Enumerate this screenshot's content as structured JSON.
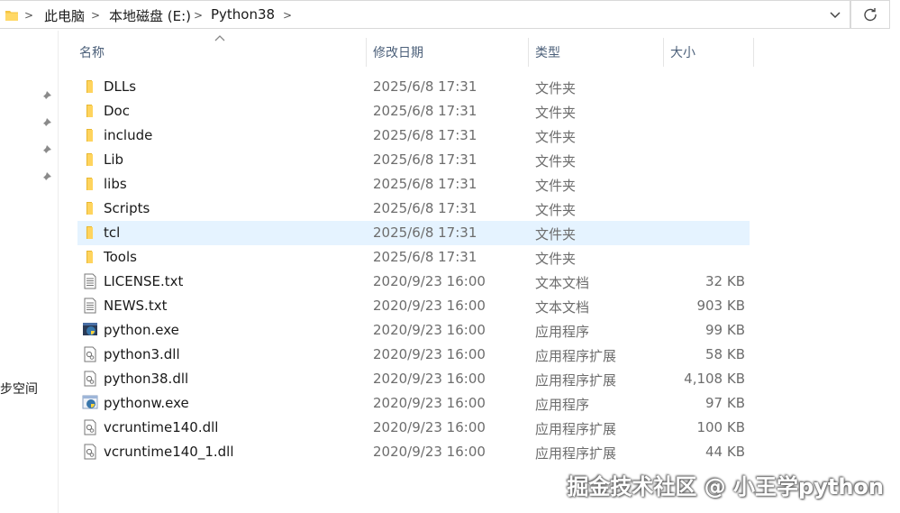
{
  "address_bar": {
    "breadcrumbs": [
      "此电脑",
      "本地磁盘 (E:)",
      "Python38"
    ]
  },
  "nav_pane": {
    "partial_label": "步空间"
  },
  "columns": {
    "name": "名称",
    "date": "修改日期",
    "type": "类型",
    "size": "大小"
  },
  "files": [
    {
      "name": "DLLs",
      "date": "2025/6/8 17:31",
      "type": "文件夹",
      "size": "",
      "icon": "folder-icon"
    },
    {
      "name": "Doc",
      "date": "2025/6/8 17:31",
      "type": "文件夹",
      "size": "",
      "icon": "folder-icon"
    },
    {
      "name": "include",
      "date": "2025/6/8 17:31",
      "type": "文件夹",
      "size": "",
      "icon": "folder-icon"
    },
    {
      "name": "Lib",
      "date": "2025/6/8 17:31",
      "type": "文件夹",
      "size": "",
      "icon": "folder-icon"
    },
    {
      "name": "libs",
      "date": "2025/6/8 17:31",
      "type": "文件夹",
      "size": "",
      "icon": "folder-icon"
    },
    {
      "name": "Scripts",
      "date": "2025/6/8 17:31",
      "type": "文件夹",
      "size": "",
      "icon": "folder-icon"
    },
    {
      "name": "tcl",
      "date": "2025/6/8 17:31",
      "type": "文件夹",
      "size": "",
      "icon": "folder-icon",
      "selected": true
    },
    {
      "name": "Tools",
      "date": "2025/6/8 17:31",
      "type": "文件夹",
      "size": "",
      "icon": "folder-icon"
    },
    {
      "name": "LICENSE.txt",
      "date": "2020/9/23 16:00",
      "type": "文本文档",
      "size": "32 KB",
      "icon": "text-file-icon"
    },
    {
      "name": "NEWS.txt",
      "date": "2020/9/23 16:00",
      "type": "文本文档",
      "size": "903 KB",
      "icon": "text-file-icon"
    },
    {
      "name": "python.exe",
      "date": "2020/9/23 16:00",
      "type": "应用程序",
      "size": "99 KB",
      "icon": "python-exe-icon"
    },
    {
      "name": "python3.dll",
      "date": "2020/9/23 16:00",
      "type": "应用程序扩展",
      "size": "58 KB",
      "icon": "dll-file-icon"
    },
    {
      "name": "python38.dll",
      "date": "2020/9/23 16:00",
      "type": "应用程序扩展",
      "size": "4,108 KB",
      "icon": "dll-file-icon"
    },
    {
      "name": "pythonw.exe",
      "date": "2020/9/23 16:00",
      "type": "应用程序",
      "size": "97 KB",
      "icon": "pythonw-exe-icon"
    },
    {
      "name": "vcruntime140.dll",
      "date": "2020/9/23 16:00",
      "type": "应用程序扩展",
      "size": "100 KB",
      "icon": "dll-file-icon"
    },
    {
      "name": "vcruntime140_1.dll",
      "date": "2020/9/23 16:00",
      "type": "应用程序扩展",
      "size": "44 KB",
      "icon": "dll-file-icon"
    }
  ],
  "watermark": "掘金技术社区 @ 小王学python",
  "colors": {
    "folder": "#f5c542",
    "selection": "#e5f3ff",
    "header_text": "#4c607a"
  }
}
